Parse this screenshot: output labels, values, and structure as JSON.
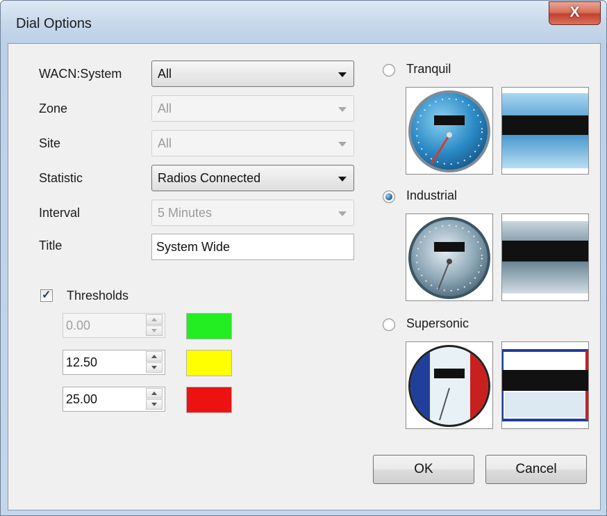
{
  "window": {
    "title": "Dial Options",
    "close_label": "X"
  },
  "fields": {
    "wacn": {
      "label": "WACN:System",
      "value": "All"
    },
    "zone": {
      "label": "Zone",
      "value": "All"
    },
    "site": {
      "label": "Site",
      "value": "All"
    },
    "statistic": {
      "label": "Statistic",
      "value": "Radios Connected"
    },
    "interval": {
      "label": "Interval",
      "value": "5 Minutes"
    },
    "title": {
      "label": "Title",
      "value": "System Wide"
    }
  },
  "thresholds": {
    "label": "Thresholds",
    "checked": true,
    "rows": [
      {
        "value": "0.00",
        "color": "#22ee22",
        "enabled": false
      },
      {
        "value": "12.50",
        "color": "#ffff00",
        "enabled": true
      },
      {
        "value": "25.00",
        "color": "#ee1111",
        "enabled": true
      }
    ]
  },
  "styles": [
    {
      "label": "Tranquil",
      "selected": false
    },
    {
      "label": "Industrial",
      "selected": true
    },
    {
      "label": "Supersonic",
      "selected": false
    }
  ],
  "buttons": {
    "ok": "OK",
    "cancel": "Cancel"
  },
  "icons": {
    "checkbox_mark": "✓"
  }
}
